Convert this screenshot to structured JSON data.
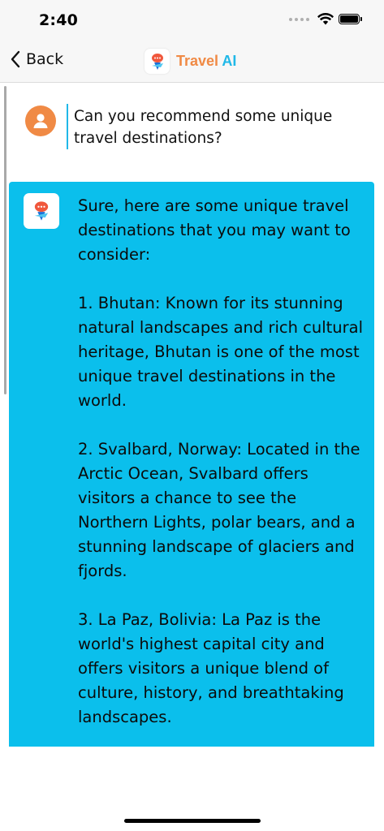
{
  "status_bar": {
    "time": "2:40",
    "icons": [
      "signal-dots-icon",
      "wifi-icon",
      "battery-icon"
    ]
  },
  "nav": {
    "back_label": "Back",
    "title_part1": "Travel",
    "title_part2": "AI",
    "colors": {
      "accent_orange": "#f08a45",
      "accent_blue": "#20b8e8"
    }
  },
  "chat": {
    "user_message": "Can you recommend some unique travel destinations?",
    "ai_message": {
      "paragraphs": [
        "Sure, here are some unique travel destinations that you may want to consider:",
        "1. Bhutan: Known for its stunning natural landscapes and rich cultural heritage, Bhutan is one of the most unique travel destinations in the world.",
        "2. Svalbard, Norway: Located in the Arctic Ocean, Svalbard offers visitors a chance to see the Northern Lights, polar bears, and a stunning landscape of glaciers and fjords.",
        "3. La Paz, Bolivia: La Paz is the world's highest capital city and offers visitors a unique blend of culture, history, and breathtaking landscapes."
      ],
      "bubble_color": "#0bbfec"
    }
  }
}
